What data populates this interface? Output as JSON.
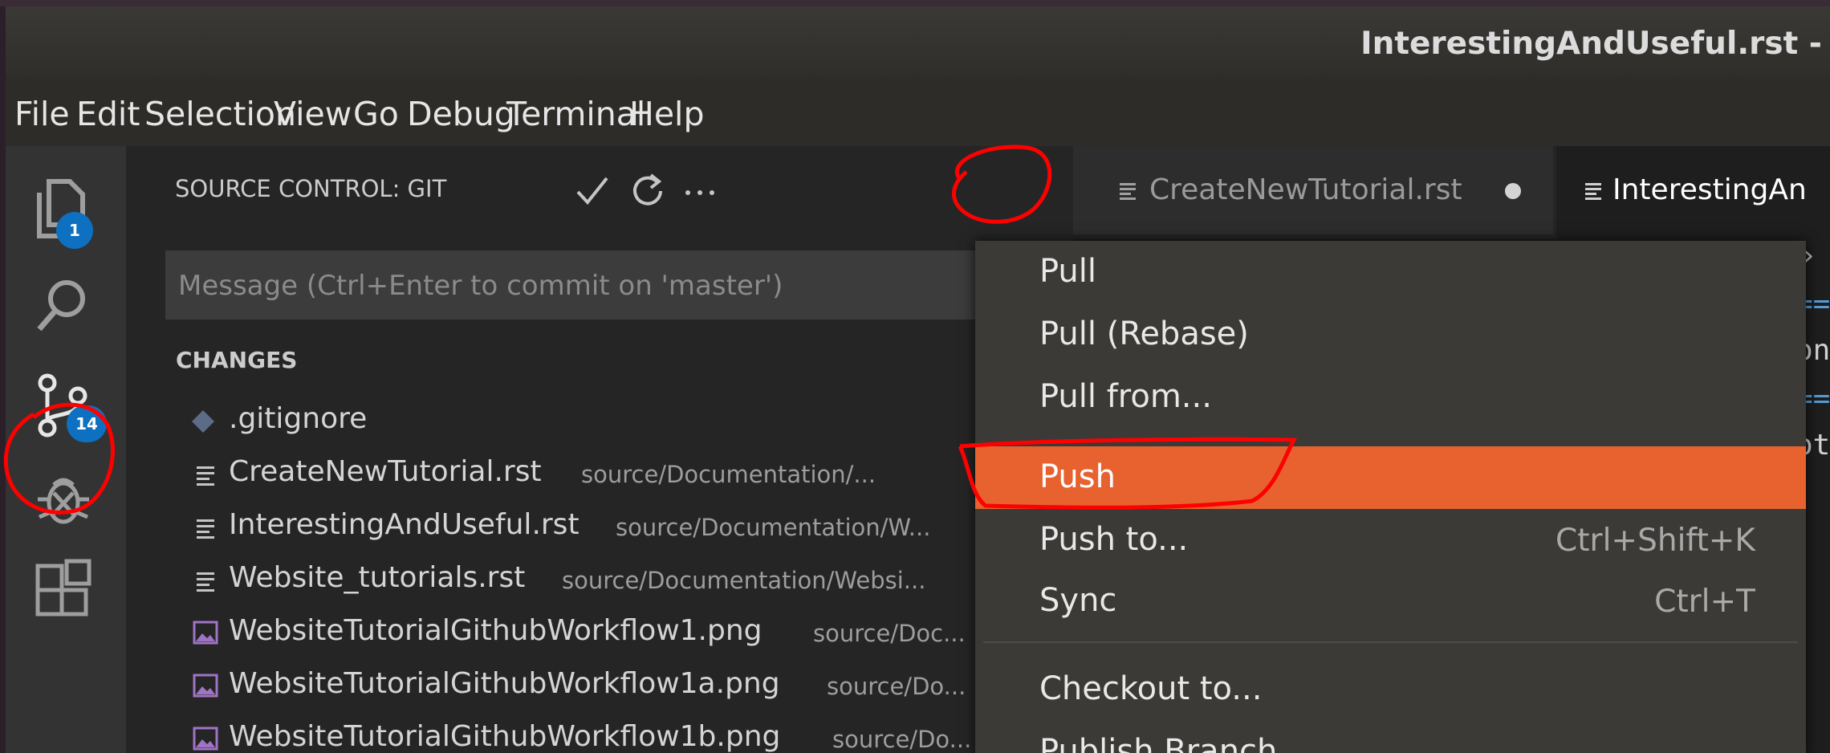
{
  "window": {
    "title": "InterestingAndUseful.rst -"
  },
  "menu": [
    "File",
    "Edit",
    "Selection",
    "View",
    "Go",
    "Debug",
    "Terminal",
    "Help"
  ],
  "activity_bar": {
    "explorer_badge": "1",
    "scm_badge": "14"
  },
  "scm": {
    "header": "SOURCE CONTROL: GIT",
    "message_placeholder": "Message (Ctrl+Enter to commit on 'master')",
    "changes_label": "CHANGES",
    "files": [
      {
        "name": ".gitignore",
        "path": ""
      },
      {
        "name": "CreateNewTutorial.rst",
        "path": "source/Documentation/..."
      },
      {
        "name": "InterestingAndUseful.rst",
        "path": "source/Documentation/W..."
      },
      {
        "name": "Website_tutorials.rst",
        "path": "source/Documentation/Websi..."
      },
      {
        "name": "WebsiteTutorialGithubWorkflow1.png",
        "path": "source/Doc..."
      },
      {
        "name": "WebsiteTutorialGithubWorkflow1a.png",
        "path": "source/Do..."
      },
      {
        "name": "WebsiteTutorialGithubWorkflow1b.png",
        "path": "source/Do..."
      }
    ]
  },
  "tabs": [
    {
      "label": "CreateNewTutorial.rst"
    },
    {
      "label": "InterestingAn"
    }
  ],
  "context_menu": {
    "items": [
      {
        "label": "Pull",
        "shortcut": ""
      },
      {
        "label": "Pull (Rebase)",
        "shortcut": ""
      },
      {
        "label": "Pull from...",
        "shortcut": ""
      },
      {
        "label": "Push",
        "shortcut": ""
      },
      {
        "label": "Push to...",
        "shortcut": "Ctrl+Shift+K"
      },
      {
        "label": "Sync",
        "shortcut": "Ctrl+T"
      },
      {
        "label": "Checkout to...",
        "shortcut": ""
      },
      {
        "label": "Publish Branch",
        "shortcut": ""
      }
    ],
    "selected": "Push"
  },
  "colors": {
    "accent_selection": "#e7622f",
    "badge": "#0e70c0",
    "annotation": "#ff0000"
  }
}
